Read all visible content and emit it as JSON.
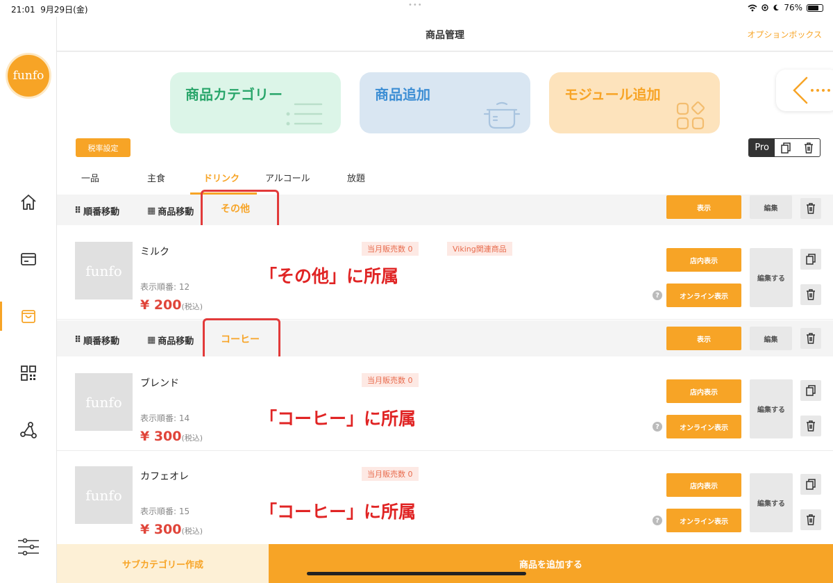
{
  "status": {
    "time": "21:01",
    "date": "9月29日(金)",
    "battery": "76%",
    "battery_level": 0.76
  },
  "sidebar": {
    "logo": "funfo"
  },
  "header": {
    "title": "商品管理",
    "option_box": "オプションボックス"
  },
  "cards": [
    {
      "label": "商品カテゴリー",
      "icon": "list-icon"
    },
    {
      "label": "商品追加",
      "icon": "pot-icon"
    },
    {
      "label": "モジュール追加",
      "icon": "module-icon"
    }
  ],
  "tax_button": "税率設定",
  "pro_label": "Pro",
  "tabs": [
    "一品",
    "主食",
    "ドリンク",
    "アルコール",
    "放題"
  ],
  "active_tab": "ドリンク",
  "subcategories": [
    {
      "order_move": "順番移動",
      "product_move": "商品移動",
      "name": "その他",
      "show_label": "表示",
      "edit_label": "編集",
      "products": [
        {
          "name": "ミルク",
          "monthly_sales": "当月販売数 0",
          "extra_tag": "Viking関連商品",
          "order": "表示順番: 12",
          "price": "¥ 200",
          "tax_note": "(税込)",
          "store_display": "店内表示",
          "online_display": "オンライン表示",
          "edit": "編集する",
          "annotation": "「その他」に所属"
        }
      ]
    },
    {
      "order_move": "順番移動",
      "product_move": "商品移動",
      "name": "コーヒー",
      "show_label": "表示",
      "edit_label": "編集",
      "products": [
        {
          "name": "ブレンド",
          "monthly_sales": "当月販売数 0",
          "order": "表示順番: 14",
          "price": "¥ 300",
          "tax_note": "(税込)",
          "store_display": "店内表示",
          "online_display": "オンライン表示",
          "edit": "編集する",
          "annotation": "「コーヒー」に所属"
        },
        {
          "name": "カフェオレ",
          "monthly_sales": "当月販売数 0",
          "order": "表示順番: 15",
          "price": "¥ 300",
          "tax_note": "(税込)",
          "store_display": "店内表示",
          "online_display": "オンライン表示",
          "edit": "編集する",
          "annotation": "「コーヒー」に所属"
        }
      ]
    }
  ],
  "thumb_logo": "funfo",
  "bottom": {
    "subcategory_create": "サブカテゴリー作成",
    "add_product": "商品を追加する"
  }
}
